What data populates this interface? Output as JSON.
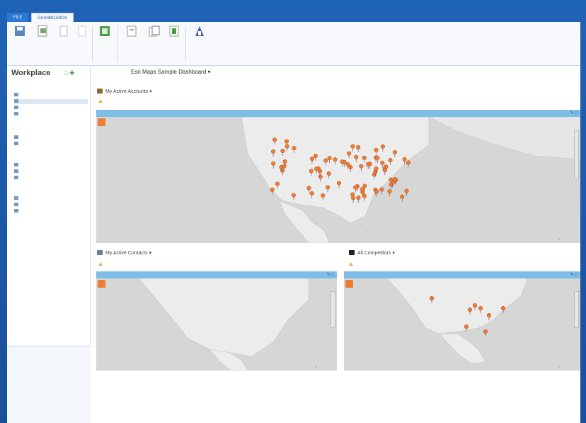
{
  "window": {
    "app_title": "",
    "user_area": ""
  },
  "tabs": [
    {
      "label": "FILE"
    },
    {
      "label": "DASHBOARDS"
    }
  ],
  "ribbon": {
    "buttons": [
      {
        "label": "",
        "icon": "save-icon"
      },
      {
        "label": "",
        "icon": "new-icon"
      },
      {
        "label": "",
        "icon": "edit-icon"
      },
      {
        "label": "",
        "icon": "delete-icon"
      },
      {
        "label": "",
        "icon": "excel-icon"
      },
      {
        "label": "",
        "icon": "share-icon"
      },
      {
        "label": "",
        "icon": "copy-icon"
      },
      {
        "label": "",
        "icon": "refresh-icon"
      },
      {
        "label": "",
        "icon": "report-icon"
      }
    ],
    "groups": [
      "",
      "",
      ""
    ]
  },
  "navpane": {
    "title": "Workplace",
    "groups": [
      {
        "label": "",
        "items": [
          "",
          "",
          "",
          ""
        ]
      },
      {
        "label": "",
        "items": [
          "",
          ""
        ]
      },
      {
        "label": "",
        "items": [
          "",
          "",
          ""
        ]
      },
      {
        "label": "",
        "items": [
          "",
          "",
          ""
        ]
      }
    ],
    "bottom": [
      "",
      "",
      "",
      "",
      "",
      ""
    ]
  },
  "dashboard": {
    "prefix": "",
    "title": "Esri Maps Sample Dashboard ▾"
  },
  "panels": [
    {
      "title": "My Active Accounts ▾",
      "subtitle": "",
      "toolbar": [
        "",
        ""
      ]
    },
    {
      "title": "My Active Contacts ▾",
      "subtitle": "",
      "toolbar": [
        "",
        ""
      ]
    },
    {
      "title": "All Competitors ▾",
      "subtitle": "",
      "toolbar": [
        "",
        ""
      ]
    }
  ],
  "colors": {
    "frame_blue": "#1f63b6",
    "map_bar": "#7dbde6",
    "marker": "#ef7d31"
  }
}
